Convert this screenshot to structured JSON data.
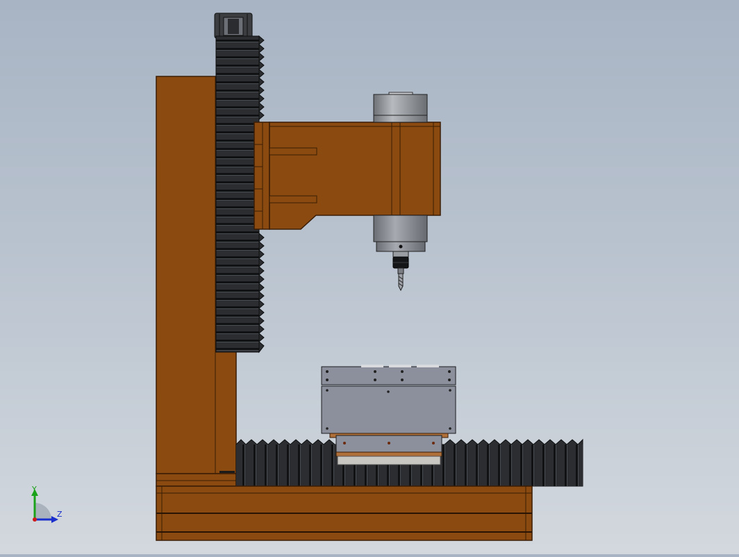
{
  "viewport": {
    "background_top": "#a8b4c4",
    "background_bottom": "#d3d8de"
  },
  "model": {
    "colors": {
      "frame": "#8b4a10",
      "frame_edge": "#3a1d05",
      "bellows": "#2a2c2e",
      "bellows_stripe": "#141516",
      "spindle": "#8a8d93",
      "table_plate": "#8c909c"
    }
  },
  "triad": {
    "y_label": "Y",
    "z_label": "Z",
    "y_color": "#1aa31a",
    "z_color": "#1a2fcc",
    "origin_color": "#d01a1a"
  }
}
